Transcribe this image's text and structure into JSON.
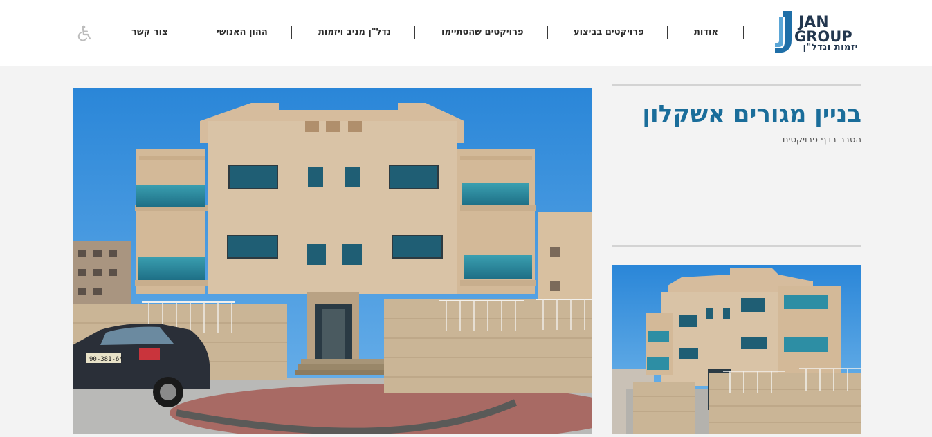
{
  "brand": {
    "name_line1": "JAN",
    "name_line2": "GROUP",
    "tagline": "יזמות ונדל\"ן",
    "color": "#1a6d9a"
  },
  "nav": {
    "items": [
      {
        "label": "אודות"
      },
      {
        "label": "פרויקטים בביצוע"
      },
      {
        "label": "פרויקטים שהסתיימו"
      },
      {
        "label": "נדל\"ן מניב ויזמות"
      },
      {
        "label": "ההון האנושי"
      },
      {
        "label": "צור קשר"
      }
    ],
    "accessibility_icon": "wheelchair-icon"
  },
  "project": {
    "title": "בניין מגורים אשקלון",
    "subtitle": "הסבר בדף פרויקטים",
    "license_plate": "90-381-64"
  },
  "colors": {
    "accent": "#1a6d9a",
    "sky": "#3a8fd8",
    "building": "#d9c3a6",
    "background": "#f3f3f3"
  }
}
